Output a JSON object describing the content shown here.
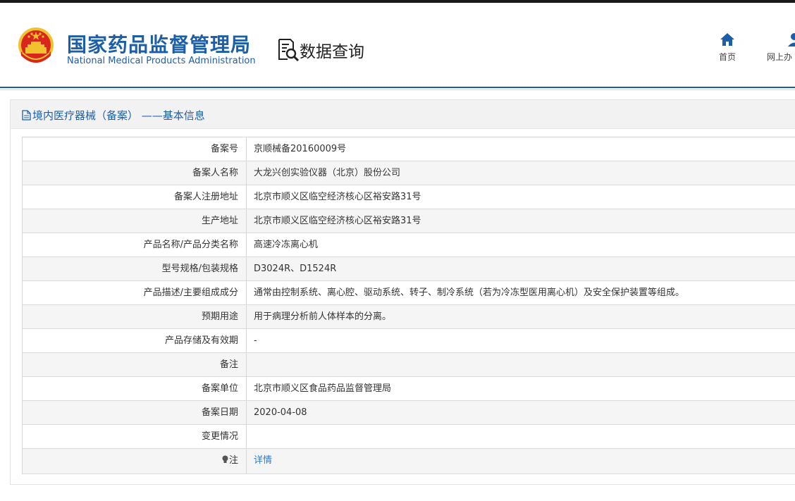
{
  "header": {
    "org_name_cn": "国家药品监督管理局",
    "org_name_en": "National Medical Products Administration",
    "section_title": "数据查询",
    "nav": [
      {
        "label": "首页",
        "icon": "home-icon"
      },
      {
        "label": "网上办",
        "icon": "user-icon"
      }
    ]
  },
  "panel": {
    "title": "境内医疗器械（备案） ——基本信息"
  },
  "record": {
    "rows": [
      {
        "label": "备案号",
        "value": "京顺械备20160009号"
      },
      {
        "label": "备案人名称",
        "value": "大龙兴创实验仪器（北京）股份公司"
      },
      {
        "label": "备案人注册地址",
        "value": "北京市顺义区临空经济核心区裕安路31号"
      },
      {
        "label": "生产地址",
        "value": "北京市顺义区临空经济核心区裕安路31号"
      },
      {
        "label": "产品名称/产品分类名称",
        "value": "高速冷冻离心机"
      },
      {
        "label": "型号规格/包装规格",
        "value": "D3024R、D1524R"
      },
      {
        "label": "产品描述/主要组成成分",
        "value": "通常由控制系统、离心腔、驱动系统、转子、制冷系统（若为冷冻型医用离心机）及安全保护装置等组成。"
      },
      {
        "label": "预期用途",
        "value": "用于病理分析前人体样本的分离。"
      },
      {
        "label": "产品存储及有效期",
        "value": "-"
      },
      {
        "label": "备注",
        "value": ""
      },
      {
        "label": "备案单位",
        "value": "北京市顺义区食品药品监督管理局"
      },
      {
        "label": "备案日期",
        "value": "2020-04-08"
      },
      {
        "label": "变更情况",
        "value": ""
      }
    ],
    "note": {
      "label": "注",
      "link_text": "详情"
    }
  },
  "colors": {
    "brand_blue": "#1d5ea8",
    "link_blue": "#2d7ac9",
    "emblem_red": "#d9261c",
    "emblem_gold": "#f2c12e"
  }
}
